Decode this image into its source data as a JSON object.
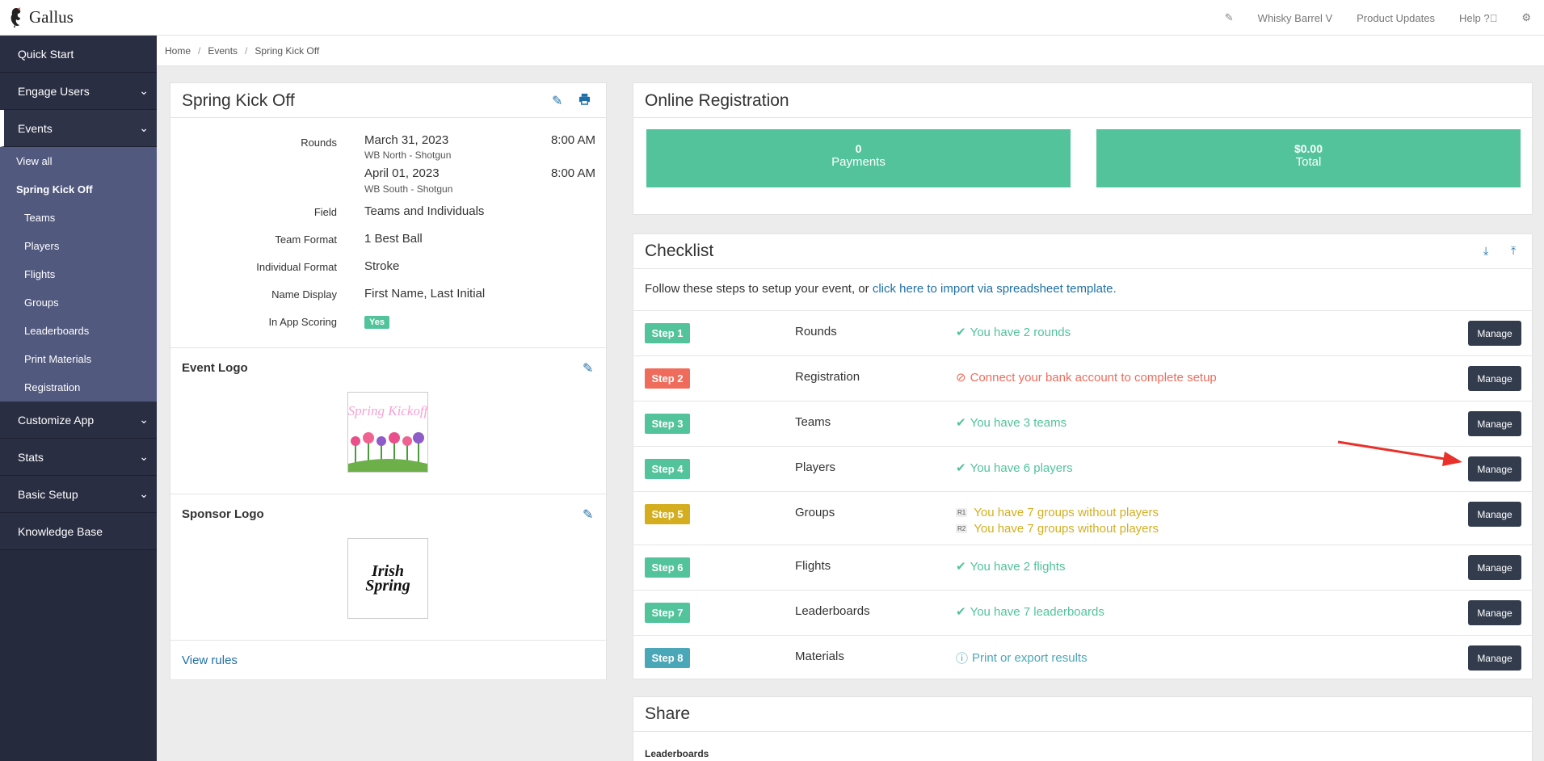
{
  "app": {
    "brand": "Gallus"
  },
  "topnav": {
    "account": "Whisky Barrel V",
    "updates": "Product Updates",
    "help": "Help"
  },
  "sidebar": {
    "quick_start": "Quick Start",
    "engage_users": "Engage Users",
    "events": "Events",
    "events_sub": [
      "View all",
      "Spring Kick Off",
      "Teams",
      "Players",
      "Flights",
      "Groups",
      "Leaderboards",
      "Print Materials",
      "Registration"
    ],
    "customize_app": "Customize App",
    "stats": "Stats",
    "basic_setup": "Basic Setup",
    "knowledge_base": "Knowledge Base"
  },
  "breadcrumb": [
    "Home",
    "Events",
    "Spring Kick Off"
  ],
  "event": {
    "title": "Spring Kick Off",
    "rounds_label": "Rounds",
    "rounds": [
      {
        "date": "March 31, 2023",
        "course": "WB North - Shotgun",
        "time": "8:00 AM"
      },
      {
        "date": "April 01, 2023",
        "course": "WB South - Shotgun",
        "time": "8:00 AM"
      }
    ],
    "details": [
      {
        "label": "Field",
        "value": "Teams and Individuals"
      },
      {
        "label": "Team Format",
        "value": "1 Best Ball"
      },
      {
        "label": "Individual Format",
        "value": "Stroke"
      },
      {
        "label": "Name Display",
        "value": "First Name, Last Initial"
      }
    ],
    "in_app_scoring_label": "In App Scoring",
    "in_app_scoring_value": "Yes",
    "event_logo_label": "Event Logo",
    "event_logo_text": "Spring Kickoff",
    "sponsor_logo_label": "Sponsor Logo",
    "sponsor_logo_text": "Irish Spring",
    "view_rules": "View rules"
  },
  "registration": {
    "title": "Online Registration",
    "payments_count": "0",
    "payments_label": "Payments",
    "total_amount": "$0.00",
    "total_label": "Total"
  },
  "checklist": {
    "title": "Checklist",
    "intro_text": "Follow these steps to setup your event, or ",
    "intro_link": "click here to import via spreadsheet template.",
    "manage_label": "Manage",
    "steps": [
      {
        "badge": "Step 1",
        "name": "Rounds",
        "status": "You have 2 rounds",
        "color": "#52c39b"
      },
      {
        "badge": "Step 2",
        "name": "Registration",
        "status": "Connect your bank account to complete setup",
        "color": "#ef6b5b"
      },
      {
        "badge": "Step 3",
        "name": "Teams",
        "status": "You have 3 teams",
        "color": "#52c39b"
      },
      {
        "badge": "Step 4",
        "name": "Players",
        "status": "You have 6 players",
        "color": "#52c39b"
      },
      {
        "badge": "Step 5",
        "name": "Groups",
        "r1_tag": "R1",
        "r2_tag": "R2",
        "status_r1": "You have 7 groups without players",
        "status_r2": "You have 7 groups without players",
        "color": "#d4ae1f"
      },
      {
        "badge": "Step 6",
        "name": "Flights",
        "status": "You have 2 flights",
        "color": "#52c39b"
      },
      {
        "badge": "Step 7",
        "name": "Leaderboards",
        "status": "You have 7 leaderboards",
        "color": "#52c39b"
      },
      {
        "badge": "Step 8",
        "name": "Materials",
        "status": "Print or export results",
        "color": "#4aa7b8"
      }
    ]
  },
  "share": {
    "title": "Share",
    "leaderboards_label": "Leaderboards"
  },
  "colors": {
    "sidebar": "#262a3d",
    "sidebar_sub": "#51597f",
    "green": "#52c39b",
    "red": "#ef6b5b",
    "yellow": "#d4ae1f",
    "teal": "#4aa7b8",
    "link": "#1f6fa8",
    "button": "#333c4d"
  }
}
